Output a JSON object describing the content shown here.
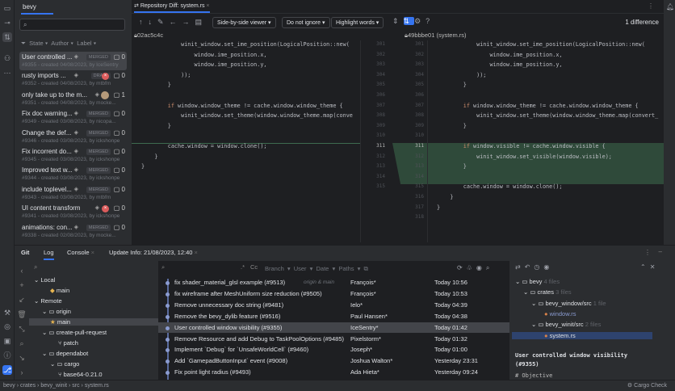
{
  "pr_panel": {
    "tab": "bevy",
    "search_placeholder": "",
    "filters": [
      "State",
      "Author",
      "Label"
    ],
    "items": [
      {
        "title": "User controlled ...",
        "sub": "#9355 - created 04/08/2023, by IceSentry",
        "badge": "MERGED",
        "comments": "0",
        "status": ""
      },
      {
        "title": "rusty imports ...",
        "sub": "#9352 - created 04/08/2023, by mtbfm",
        "badge": "DRAFT",
        "comments": "0",
        "status": "error"
      },
      {
        "title": "only take up to the m...",
        "sub": "#9351 - created 04/08/2023, by mocke...",
        "badge": "",
        "comments": "1",
        "status": "avatar"
      },
      {
        "title": "Fix doc warning...",
        "sub": "#9349 - created 03/08/2023, by nicopa...",
        "badge": "MERGED",
        "comments": "0",
        "status": ""
      },
      {
        "title": "Change the def...",
        "sub": "#9346 - created 03/08/2023, by ickshonpe",
        "badge": "MERGED",
        "comments": "0",
        "status": ""
      },
      {
        "title": "Fix incorrent do...",
        "sub": "#9345 - created 03/08/2023, by ickshonpe",
        "badge": "MERGED",
        "comments": "0",
        "status": ""
      },
      {
        "title": "Improved text w...",
        "sub": "#9344 - created 03/08/2023, by ickshonpe",
        "badge": "MERGED",
        "comments": "0",
        "status": ""
      },
      {
        "title": "include toplevel...",
        "sub": "#9343 - created 03/08/2023, by mtbfm",
        "badge": "MERGED",
        "comments": "0",
        "status": ""
      },
      {
        "title": "UI content transform",
        "sub": "#9341 - created 03/08/2023, by ickshonpe",
        "badge": "",
        "comments": "0",
        "status": "error"
      },
      {
        "title": "animations: con...",
        "sub": "#9338 - created 02/08/2023, by mocke...",
        "badge": "MERGED",
        "comments": "0",
        "status": ""
      }
    ]
  },
  "diff": {
    "tab": "Repository Diff: system.rs",
    "viewer": "Side-by-side viewer",
    "ignore": "Do not ignore",
    "highlight": "Highlight words",
    "difference_count": "1 difference",
    "left_rev": "02ac5c4c",
    "right_rev": "49bbbe01 (system.rs)",
    "left_lines": [
      {
        "n": "301",
        "t": "            winit_window.set_ime_position(LogicalPosition::new("
      },
      {
        "n": "302",
        "t": "                window.ime_position.x,"
      },
      {
        "n": "303",
        "t": "                window.ime_position.y,"
      },
      {
        "n": "304",
        "t": "            ));"
      },
      {
        "n": "305",
        "t": "        }"
      },
      {
        "n": "306",
        "t": ""
      },
      {
        "n": "307",
        "t": "        if window.window_theme != cache.window.window_theme {"
      },
      {
        "n": "308",
        "t": "            winit_window.set_theme(window.window_theme.map(conve"
      },
      {
        "n": "309",
        "t": "        }"
      },
      {
        "n": "310",
        "t": ""
      },
      {
        "n": "311",
        "t": "        cache.window = window.clone();"
      },
      {
        "n": "312",
        "t": "    }"
      },
      {
        "n": "313",
        "t": "}"
      },
      {
        "n": "314",
        "t": ""
      },
      {
        "n": "315",
        "t": ""
      }
    ],
    "right_lines": [
      {
        "n": "301",
        "t": "            winit_window.set_ime_position(LogicalPosition::new("
      },
      {
        "n": "302",
        "t": "                window.ime_position.x,"
      },
      {
        "n": "303",
        "t": "                window.ime_position.y,"
      },
      {
        "n": "304",
        "t": "            ));"
      },
      {
        "n": "305",
        "t": "        }"
      },
      {
        "n": "306",
        "t": ""
      },
      {
        "n": "307",
        "t": "        if window.window_theme != cache.window.window_theme {"
      },
      {
        "n": "308",
        "t": "            winit_window.set_theme(window.window_theme.map(convert_"
      },
      {
        "n": "309",
        "t": "        }"
      },
      {
        "n": "310",
        "t": ""
      },
      {
        "n": "311",
        "t": "        if window.visible != cache.window.visible {"
      },
      {
        "n": "312",
        "t": "            winit_window.set_visible(window.visible);"
      },
      {
        "n": "313",
        "t": "        }"
      },
      {
        "n": "314",
        "t": ""
      },
      {
        "n": "315",
        "t": "        cache.window = window.clone();"
      },
      {
        "n": "316",
        "t": "    }"
      },
      {
        "n": "317",
        "t": "}"
      },
      {
        "n": "318",
        "t": ""
      }
    ]
  },
  "bottom": {
    "tabs": [
      "Git",
      "Log",
      "Console",
      "Update Info: 21/08/2023, 12:40"
    ],
    "branches": [
      {
        "label": "Local",
        "level": 0,
        "icon": "chevron"
      },
      {
        "label": "main",
        "level": 2,
        "icon": "tag"
      },
      {
        "label": "Remote",
        "level": 0,
        "icon": "chevron"
      },
      {
        "label": "origin",
        "level": 1,
        "icon": "folder"
      },
      {
        "label": "main",
        "level": 2,
        "icon": "star"
      },
      {
        "label": "create-pull-request",
        "level": 1,
        "icon": "folder"
      },
      {
        "label": "patch",
        "level": 3,
        "icon": "branch"
      },
      {
        "label": "dependabot",
        "level": 1,
        "icon": "folder"
      },
      {
        "label": "cargo",
        "level": 2,
        "icon": "folder"
      },
      {
        "label": "base64-0.21.0",
        "level": 3,
        "icon": "branch"
      }
    ],
    "log_filters": [
      "Branch",
      "User",
      "Date",
      "Paths"
    ],
    "commits": [
      {
        "msg": "fix shader_material_glsl example (#9513)",
        "refs": "origin & main",
        "author": "François*",
        "date": "Today 10:56"
      },
      {
        "msg": "fix wireframe after MeshUniform size reduction (#9505)",
        "refs": "",
        "author": "François*",
        "date": "Today 10:53"
      },
      {
        "msg": "Remove unnecessary doc string (#9481)",
        "refs": "",
        "author": "Ielo*",
        "date": "Today 04:39"
      },
      {
        "msg": "Remove the bevy_dylib feature (#9516)",
        "refs": "",
        "author": "Paul Hansen*",
        "date": "Today 04:38"
      },
      {
        "msg": "User controlled window visibility (#9355)",
        "refs": "",
        "author": "IceSentry*",
        "date": "Today 01:42"
      },
      {
        "msg": "Remove Resource and add Debug to TaskPoolOptions (#9485)",
        "refs": "",
        "author": "Pixelstorm*",
        "date": "Today 01:32"
      },
      {
        "msg": "Implement `Debug` for `UnsafeWorldCell` (#9460)",
        "refs": "",
        "author": "Joseph*",
        "date": "Today 01:00"
      },
      {
        "msg": "Add `GamepadButtonInput` event (#9008)",
        "refs": "",
        "author": "Joshua Walton*",
        "date": "Yesterday 23:31"
      },
      {
        "msg": "Fix point light radius (#9493)",
        "refs": "",
        "author": "Ada Hieta*",
        "date": "Yesterday 09:24"
      }
    ],
    "changes": [
      {
        "label": "bevy",
        "meta": "4 files",
        "level": 0
      },
      {
        "label": "crates",
        "meta": "3 files",
        "level": 1
      },
      {
        "label": "bevy_window/src",
        "meta": "1 file",
        "level": 2
      },
      {
        "label": "window.rs",
        "meta": "",
        "level": 3
      },
      {
        "label": "bevy_winit/src",
        "meta": "2 files",
        "level": 2
      },
      {
        "label": "system.rs",
        "meta": "",
        "level": 3
      }
    ],
    "commit_message": "User controlled window visibility\n(#9355)",
    "commit_message_more": "# Objective"
  },
  "status": {
    "breadcrumb": [
      "bevy",
      "crates",
      "bevy_winit",
      "src",
      "system.rs"
    ],
    "cargo_check": "Cargo Check"
  },
  "colors": {
    "accent": "#3574f0",
    "added": "#2f4a3a",
    "selection": "#2e436e"
  }
}
